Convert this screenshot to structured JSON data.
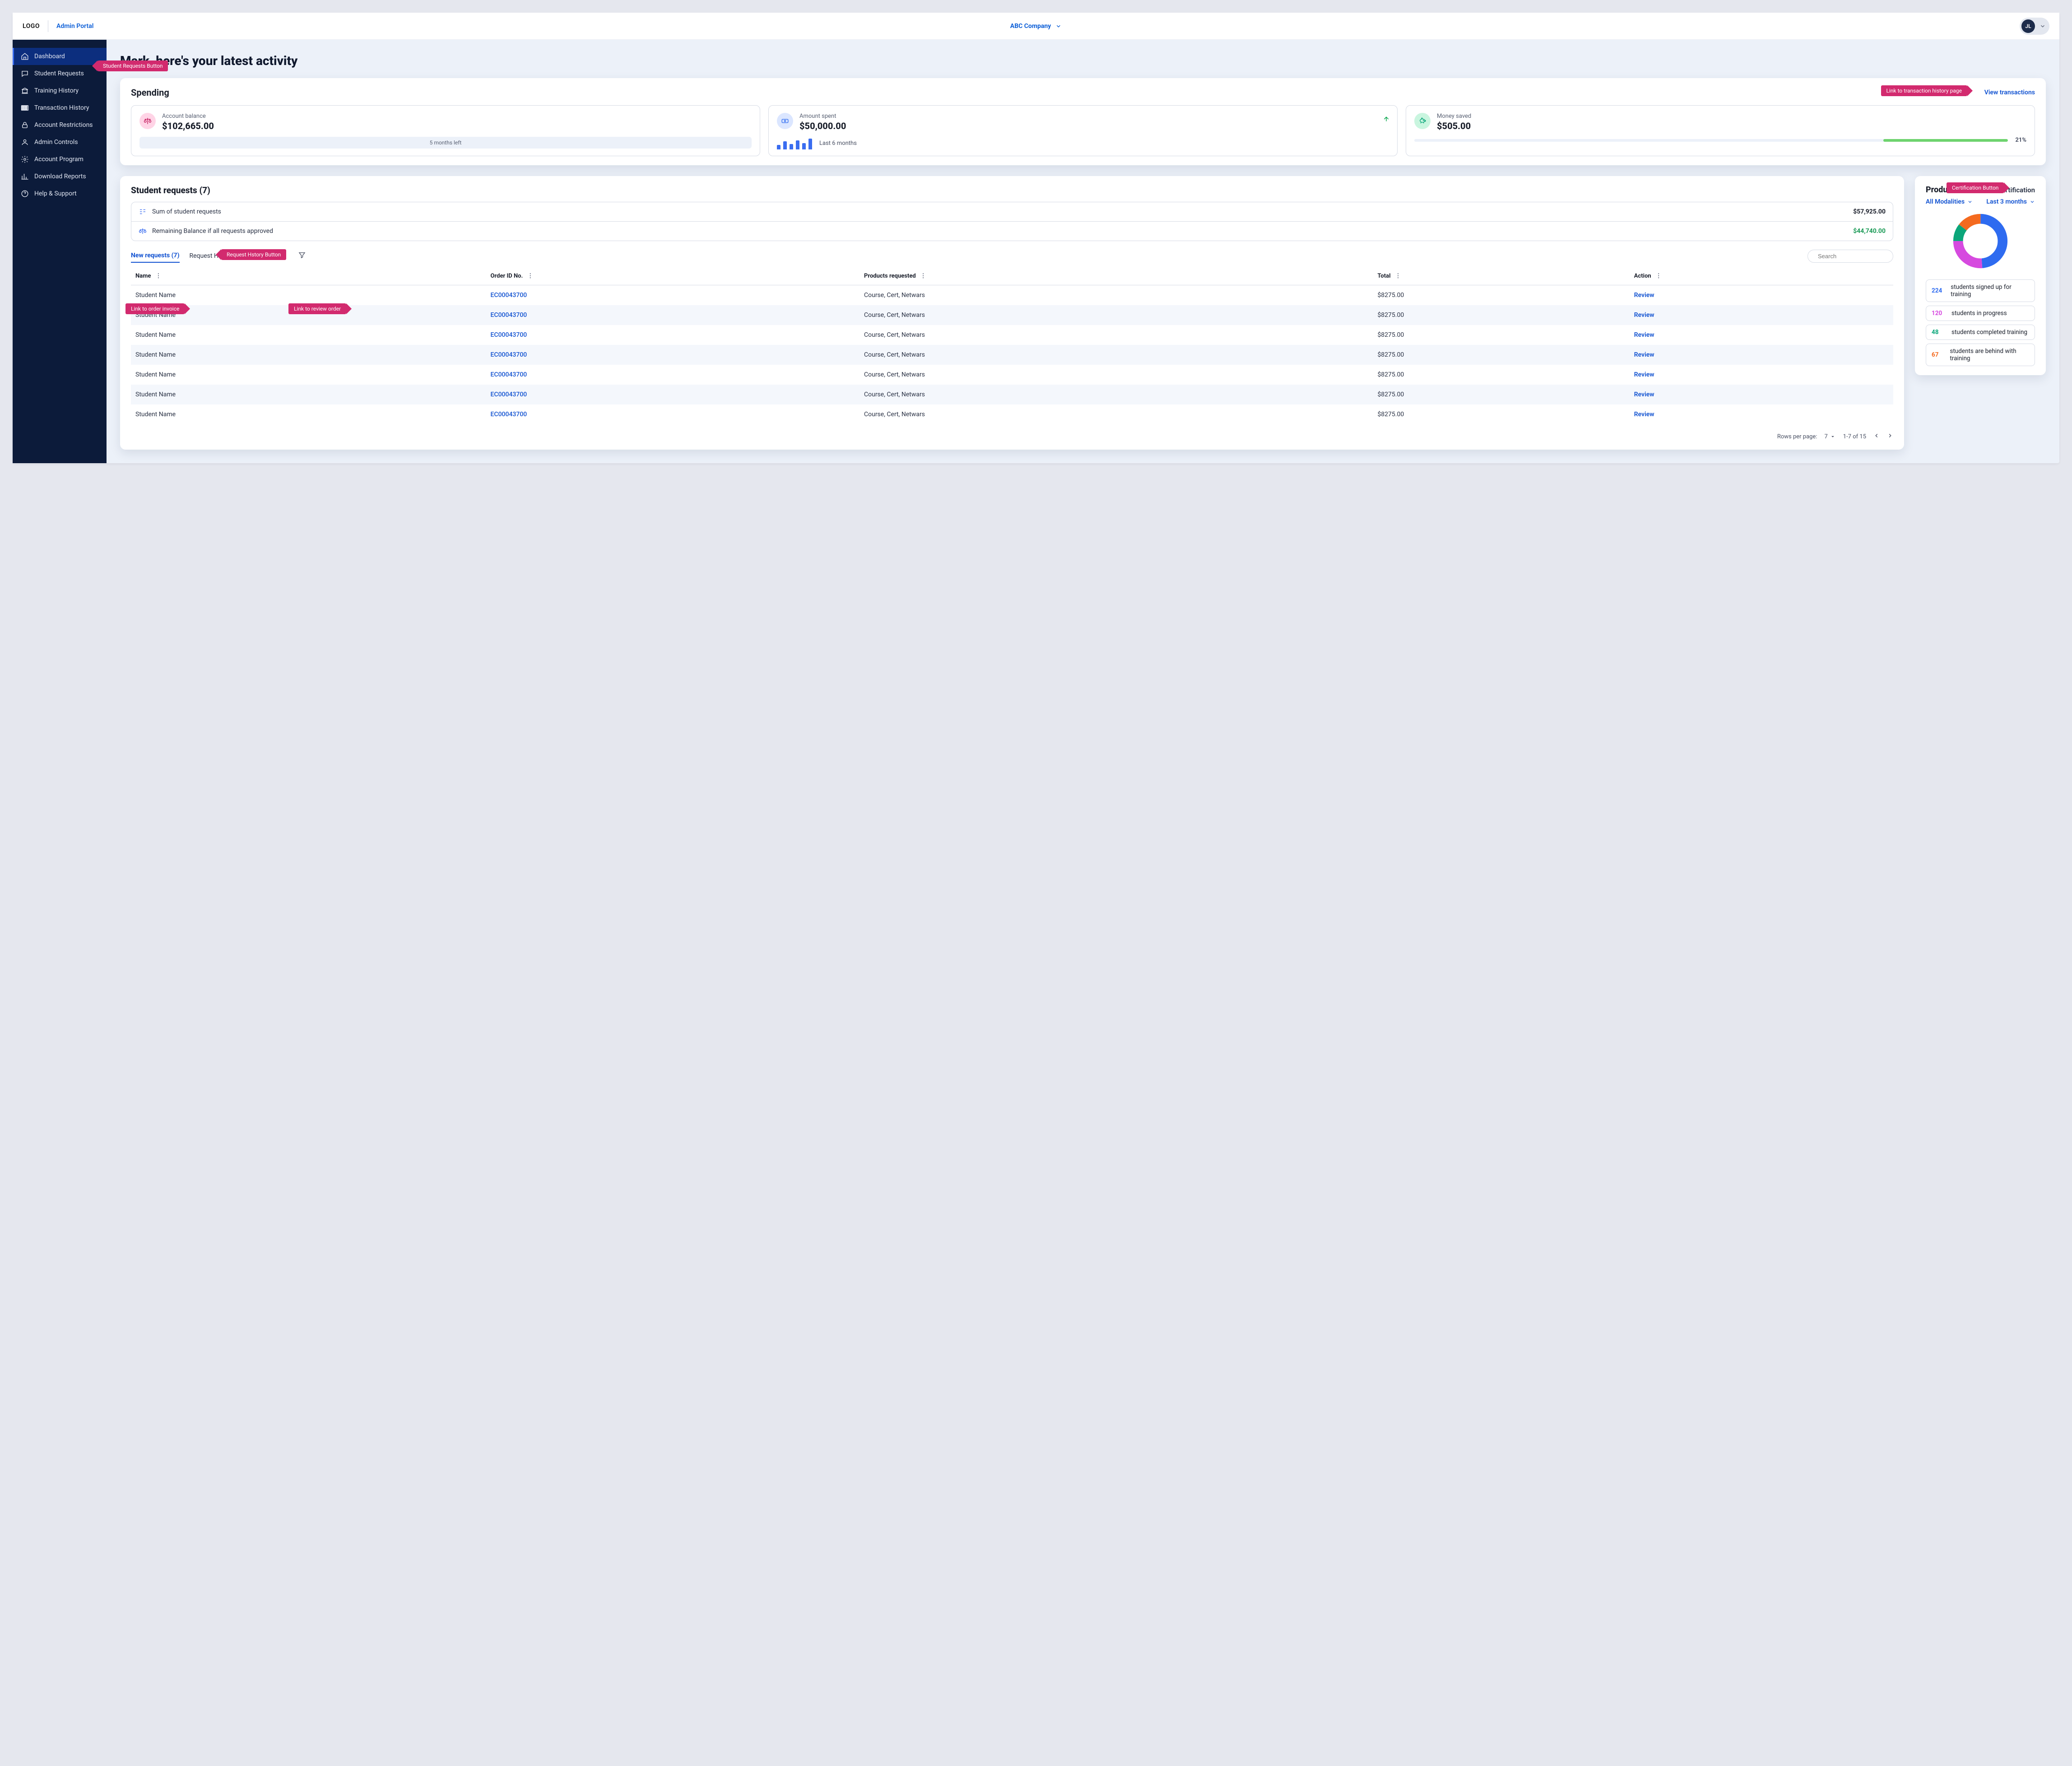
{
  "header": {
    "logo": "LOGO",
    "portal": "Admin Portal",
    "company": "ABC Company",
    "avatar_initials": "JL"
  },
  "sidebar": {
    "items": [
      {
        "label": "Dashboard",
        "icon": "home",
        "active": true
      },
      {
        "label": "Student Requests",
        "icon": "message"
      },
      {
        "label": "Training History",
        "icon": "bank"
      },
      {
        "label": "Transaction History",
        "icon": "barcode"
      },
      {
        "label": "Account Restrictions",
        "icon": "lock"
      },
      {
        "label": "Admin Controls",
        "icon": "user"
      },
      {
        "label": "Account Program",
        "icon": "gear"
      },
      {
        "label": "Download Reports",
        "icon": "chart"
      },
      {
        "label": "Help & Support",
        "icon": "help"
      }
    ]
  },
  "page_title": "Mark, here's your latest activity",
  "spending": {
    "title": "Spending",
    "view_transactions": "View transactions",
    "balance": {
      "label": "Account balance",
      "value": "$102,665.00",
      "months_left": "5 months left"
    },
    "spent": {
      "label": "Amount spent",
      "value": "$50,000.00",
      "period": "Last 6 months"
    },
    "saved": {
      "label": "Money saved",
      "value": "$505.00",
      "pct": "21%"
    }
  },
  "requests": {
    "title": "Student requests (7)",
    "sum_label": "Sum of student requests",
    "sum_value": "$57,925.00",
    "remain_label": "Remaining Balance if all requests approved",
    "remain_value": "$44,740.00",
    "tab_new": "New requests (7)",
    "tab_history": "Request History",
    "search_placeholder": "Search",
    "columns": [
      "Name",
      "Order ID No.",
      "Products requested",
      "Total",
      "Action"
    ],
    "rows": [
      {
        "name": "Student Name",
        "order": "EC00043700",
        "products": "Course, Cert, Netwars",
        "total": "$8275.00",
        "action": "Review"
      },
      {
        "name": "Student Name",
        "order": "EC00043700",
        "products": "Course, Cert, Netwars",
        "total": "$8275.00",
        "action": "Review"
      },
      {
        "name": "Student Name",
        "order": "EC00043700",
        "products": "Course, Cert, Netwars",
        "total": "$8275.00",
        "action": "Review"
      },
      {
        "name": "Student Name",
        "order": "EC00043700",
        "products": "Course, Cert, Netwars",
        "total": "$8275.00",
        "action": "Review"
      },
      {
        "name": "Student Name",
        "order": "EC00043700",
        "products": "Course, Cert, Netwars",
        "total": "$8275.00",
        "action": "Review"
      },
      {
        "name": "Student Name",
        "order": "EC00043700",
        "products": "Course, Cert, Netwars",
        "total": "$8275.00",
        "action": "Review"
      },
      {
        "name": "Student Name",
        "order": "EC00043700",
        "products": "Course, Cert, Netwars",
        "total": "$8275.00",
        "action": "Review"
      }
    ],
    "pager": {
      "rows_label": "Rows per page:",
      "rows": "7",
      "range": "1-7 of 15"
    }
  },
  "totals": {
    "title": "Product to",
    "cert": "Certification",
    "modality": "All Modalities",
    "period": "Last 3 months",
    "items": [
      {
        "num": "224",
        "text": "students signed up for training",
        "color": "#2e6bf0"
      },
      {
        "num": "120",
        "text": "students in progress",
        "color": "#d64adf"
      },
      {
        "num": "48",
        "text": "students completed training",
        "color": "#0ba67a"
      },
      {
        "num": "67",
        "text": "students are behind with training",
        "color": "#f46a1f"
      }
    ]
  },
  "tags": {
    "student_requests": "Student Requests Button",
    "tx_history": "Link to transaction history page",
    "request_history": "Request Hstory Button",
    "order_invoice": "Link to order invoice",
    "review_order": "Link to review order",
    "certification": "Certification Button"
  },
  "chart_data": [
    {
      "type": "bar",
      "title": "Amount spent last 6 months (icon sparkline)",
      "categories": [
        "M1",
        "M2",
        "M3",
        "M4",
        "M5",
        "M6"
      ],
      "values": [
        10,
        18,
        12,
        20,
        14,
        24
      ],
      "ylim": [
        0,
        28
      ]
    },
    {
      "type": "pie",
      "title": "Product totals donut",
      "series": [
        {
          "name": "students signed up for training",
          "value": 224,
          "color": "#2e6bf0"
        },
        {
          "name": "students in progress",
          "value": 120,
          "color": "#d64adf"
        },
        {
          "name": "students completed training",
          "value": 48,
          "color": "#0ba67a"
        },
        {
          "name": "students are behind with training",
          "value": 67,
          "color": "#f46a1f"
        }
      ]
    }
  ]
}
